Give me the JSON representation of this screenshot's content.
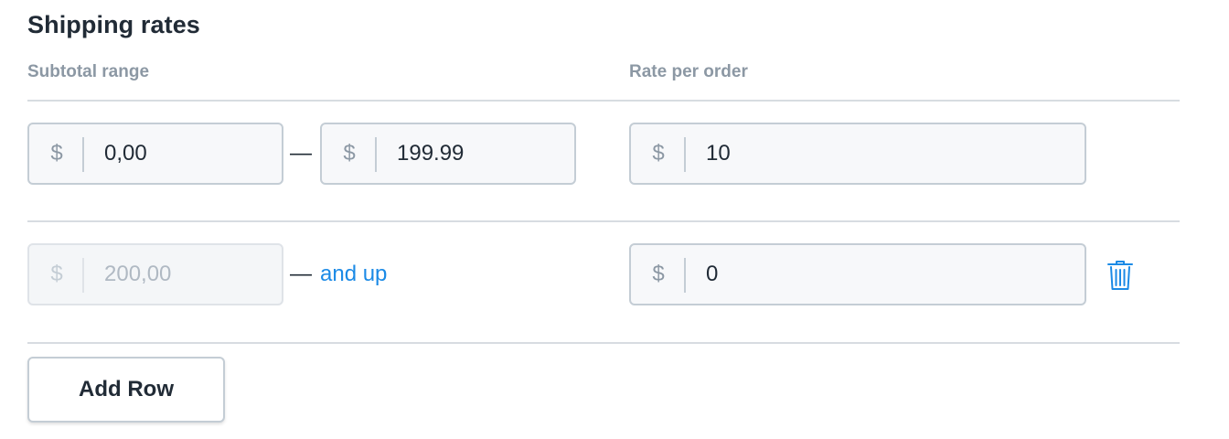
{
  "section": {
    "title": "Shipping rates",
    "columns": {
      "subtotal_range": "Subtotal range",
      "rate_per_order": "Rate per order"
    }
  },
  "currency_symbol": "$",
  "range_separator": "—",
  "rows": [
    {
      "min_value": "0,00",
      "max_value": "199.99",
      "rate": "10"
    },
    {
      "min_value": "200,00",
      "and_up_label": "and up",
      "rate": "0",
      "delete_icon": "trash-icon"
    }
  ],
  "add_row_label": "Add Row",
  "colors": {
    "accent": "#1b8ae6",
    "border": "#c4cdd5",
    "muted_text": "#8c98a4"
  }
}
